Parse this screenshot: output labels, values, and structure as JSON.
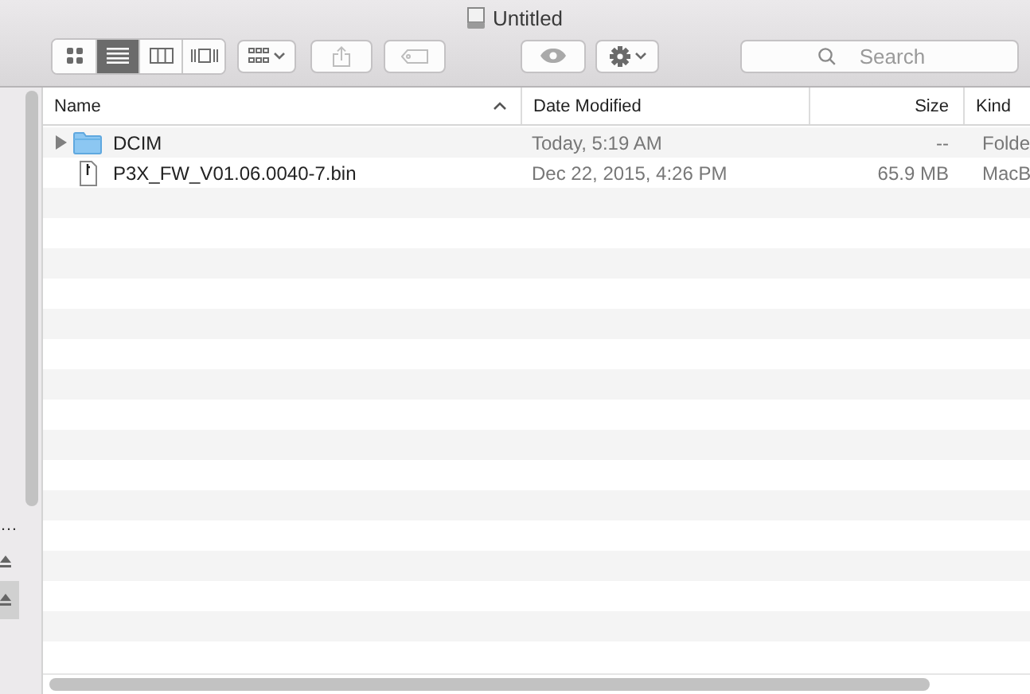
{
  "window": {
    "title": "Untitled"
  },
  "toolbar": {
    "view_modes": [
      {
        "kind": "icons",
        "selected": false
      },
      {
        "kind": "list",
        "selected": true
      },
      {
        "kind": "columns",
        "selected": false
      },
      {
        "kind": "cover",
        "selected": false
      }
    ],
    "search": {
      "placeholder": "Search"
    }
  },
  "sidebar": {
    "items": [
      {
        "kind": "label",
        "label": "…",
        "selected": false
      },
      {
        "kind": "eject",
        "selected": false
      },
      {
        "kind": "eject",
        "selected": true
      }
    ]
  },
  "table": {
    "columns": [
      {
        "label": "Name",
        "sorted": true
      },
      {
        "label": "Date Modified",
        "sorted": false
      },
      {
        "label": "Size",
        "sorted": false
      },
      {
        "label": "Kind",
        "sorted": false
      }
    ],
    "rows": [
      {
        "kind": "folder",
        "name": "DCIM",
        "date": "Today, 5:19 AM",
        "size": "--",
        "file_kind": "Folde"
      },
      {
        "kind": "file",
        "name": "P3X_FW_V01.06.0040-7.bin",
        "date": "Dec 22, 2015, 4:26 PM",
        "size": "65.9 MB",
        "file_kind": "MacB"
      }
    ]
  }
}
